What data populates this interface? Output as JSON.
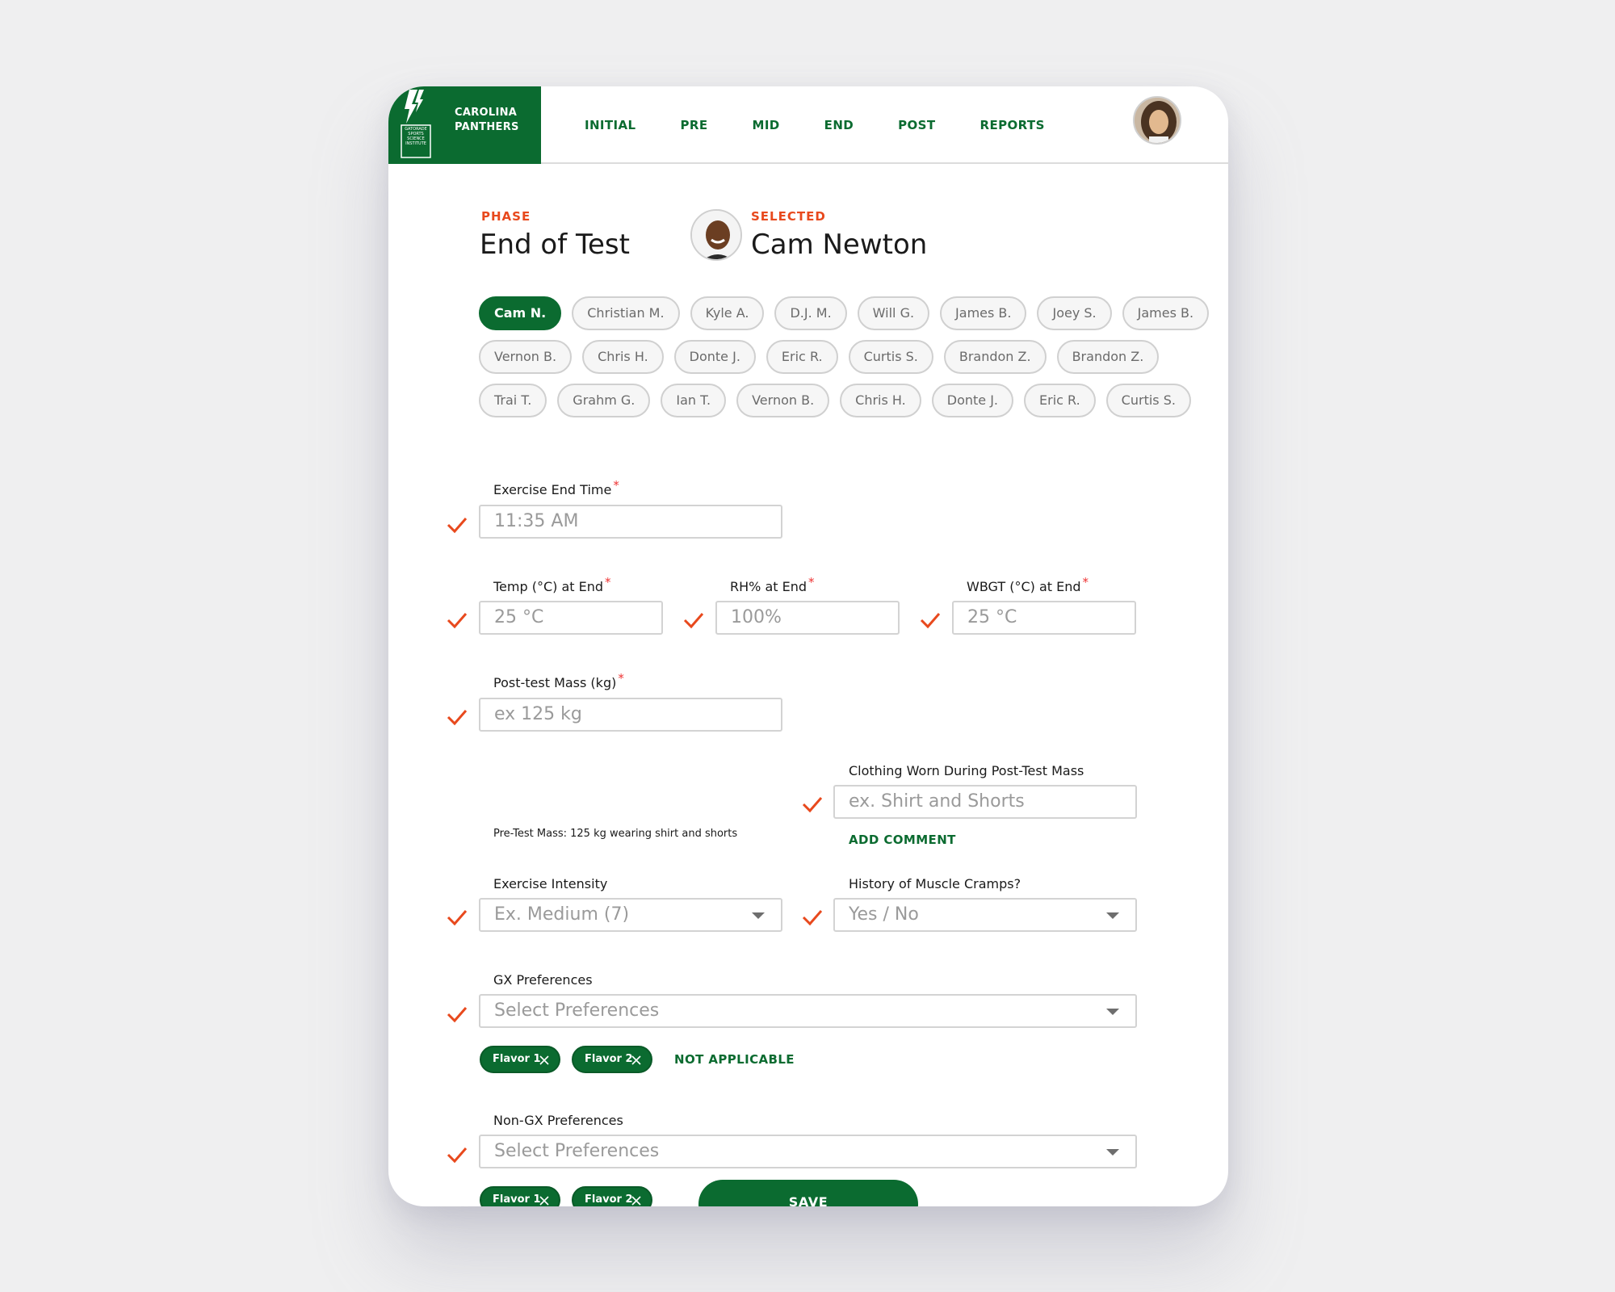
{
  "brand": {
    "logo_text": "GATORADE SPORTS SCIENCE INSTITUTE",
    "team_line1": "CAROLINA",
    "team_line2": "PANTHERS"
  },
  "nav": [
    "INITIAL",
    "PRE",
    "MID",
    "END",
    "POST",
    "REPORTS"
  ],
  "header": {
    "phase_label": "PHASE",
    "phase_value": "End of Test",
    "selected_label": "SELECTED",
    "selected_value": "Cam Newton"
  },
  "players": [
    [
      "Cam N.",
      "Christian M.",
      "Kyle A.",
      "D.J. M.",
      "Will G.",
      "James B.",
      "Joey S.",
      "James B."
    ],
    [
      "Vernon B.",
      "Chris H.",
      "Donte J.",
      "Eric R.",
      "Curtis S.",
      "Brandon Z.",
      "Brandon Z."
    ],
    [
      "Trai T.",
      "Grahm G.",
      "Ian T.",
      "Vernon B.",
      "Chris H.",
      "Donte J.",
      "Eric R.",
      "Curtis S."
    ]
  ],
  "form": {
    "end_time": {
      "label": "Exercise End Time",
      "required": "*",
      "placeholder": "11:35 AM"
    },
    "temp": {
      "label": "Temp (°C) at End",
      "required": "*",
      "placeholder": "25 °C"
    },
    "rh": {
      "label": "RH% at End",
      "required": "*",
      "placeholder": "100%"
    },
    "wbgt": {
      "label": "WBGT (°C) at End",
      "required": "*",
      "placeholder": "25 °C"
    },
    "mass": {
      "label": "Post-test Mass (kg)",
      "required": "*",
      "placeholder": "ex 125 kg",
      "hint": "Pre-Test Mass: 125 kg wearing shirt and shorts"
    },
    "clothing": {
      "label": "Clothing Worn During Post-Test Mass",
      "placeholder": "ex. Shirt and Shorts",
      "add_comment": "ADD COMMENT"
    },
    "intensity": {
      "label": "Exercise Intensity",
      "placeholder": "Ex. Medium (7)"
    },
    "cramps": {
      "label": "History of Muscle Cramps?",
      "placeholder": "Yes / No"
    },
    "gx": {
      "label": "GX Preferences",
      "placeholder": "Select Preferences",
      "tags": [
        "Flavor 1",
        "Flavor 2"
      ],
      "not_applicable": "NOT APPLICABLE"
    },
    "nongx": {
      "label": "Non-GX Preferences",
      "placeholder": "Select Preferences",
      "tags": [
        "Flavor 1",
        "Flavor 2"
      ]
    }
  },
  "save_label": "SAVE",
  "colors": {
    "brand_green": "#0b6b30",
    "accent_orange": "#e8491d",
    "required_red": "#e33333"
  }
}
